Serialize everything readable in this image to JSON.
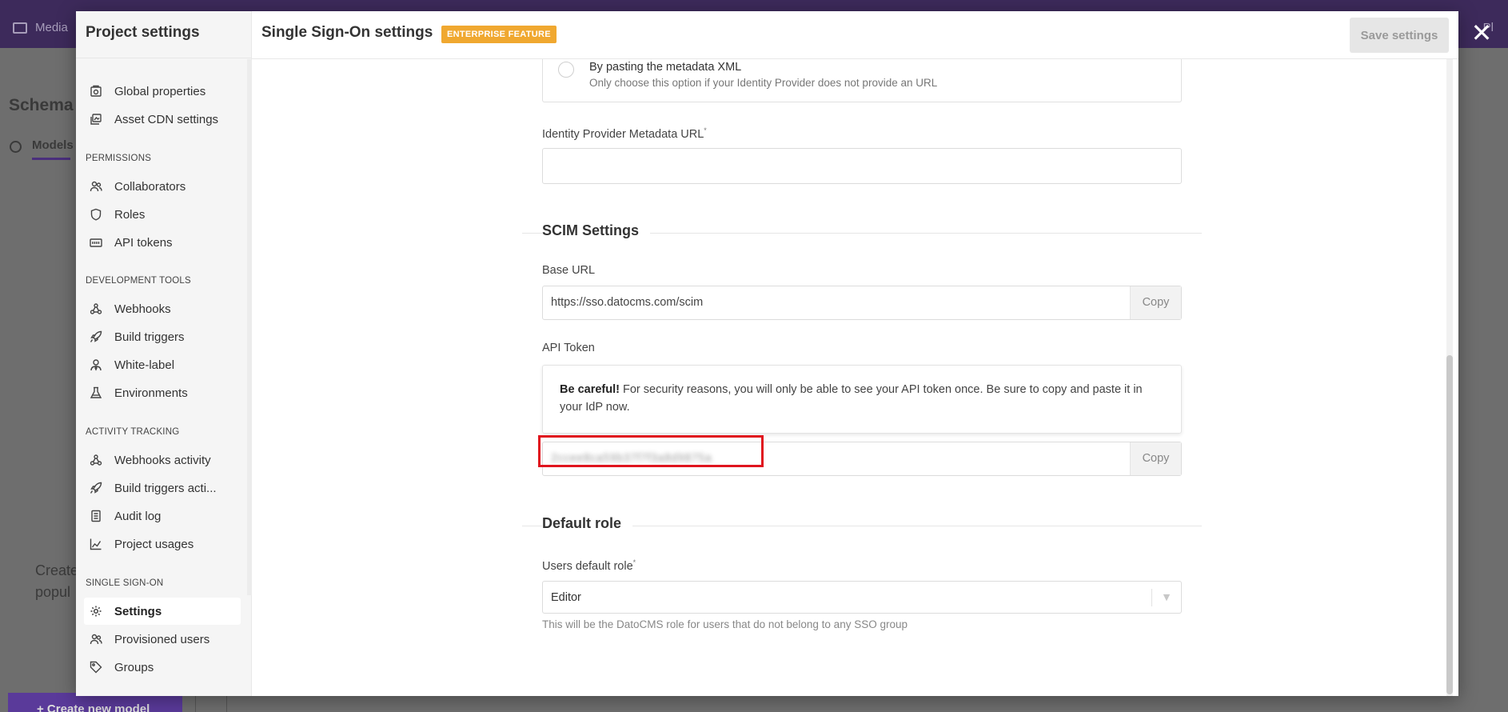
{
  "background": {
    "topbar_media_label": "Media",
    "topbar_right_label": "Pl",
    "schema_title": "Schema",
    "models_tab": "Models",
    "empty_text_line1": "Create",
    "empty_text_line2": "popul",
    "create_button": "+ Create new model"
  },
  "sidebar": {
    "title": "Project settings",
    "top_items": [
      {
        "label": "Global properties",
        "icon": "globe-doc-icon"
      },
      {
        "label": "Asset CDN settings",
        "icon": "images-icon"
      }
    ],
    "sections": [
      {
        "title": "PERMISSIONS",
        "items": [
          {
            "label": "Collaborators",
            "icon": "users-icon"
          },
          {
            "label": "Roles",
            "icon": "shield-icon"
          },
          {
            "label": "API tokens",
            "icon": "keyboard-icon"
          }
        ]
      },
      {
        "title": "DEVELOPMENT TOOLS",
        "items": [
          {
            "label": "Webhooks",
            "icon": "webhook-icon"
          },
          {
            "label": "Build triggers",
            "icon": "rocket-icon"
          },
          {
            "label": "White-label",
            "icon": "user-tie-icon"
          },
          {
            "label": "Environments",
            "icon": "flask-icon"
          }
        ]
      },
      {
        "title": "ACTIVITY TRACKING",
        "items": [
          {
            "label": "Webhooks activity",
            "icon": "webhook-icon"
          },
          {
            "label": "Build triggers acti...",
            "icon": "rocket-icon"
          },
          {
            "label": "Audit log",
            "icon": "clipboard-icon"
          },
          {
            "label": "Project usages",
            "icon": "chart-area-icon"
          }
        ]
      },
      {
        "title": "SINGLE SIGN-ON",
        "items": [
          {
            "label": "Settings",
            "icon": "gear-icon",
            "active": true
          },
          {
            "label": "Provisioned users",
            "icon": "users-icon"
          },
          {
            "label": "Groups",
            "icon": "tag-icon"
          }
        ]
      }
    ]
  },
  "header": {
    "title": "Single Sign-On settings",
    "badge": "ENTERPRISE FEATURE",
    "save_button": "Save settings"
  },
  "form": {
    "radio_title": "By pasting the metadata XML",
    "radio_description": "Only choose this option if your Identity Provider does not provide an URL",
    "metadata_url_label": "Identity Provider Metadata URL",
    "metadata_url_value": "",
    "required_mark": "*",
    "scim_section_title": "SCIM Settings",
    "base_url_label": "Base URL",
    "base_url_value": "https://sso.datocms.com/scim",
    "copy_label": "Copy",
    "api_token_label": "API Token",
    "warning_bold": "Be careful!",
    "warning_text": " For security reasons, you will only be able to see your API token once. Be sure to copy and paste it in your IdP now.",
    "api_token_value": "2ccee8ca59b37f7f3a8d9875a",
    "default_role_section_title": "Default role",
    "users_default_role_label": "Users default role",
    "users_default_role_value": "Editor",
    "users_default_role_hint": "This will be the DatoCMS role for users that do not belong to any SSO group"
  },
  "colors": {
    "badge": "#f0a830",
    "highlight": "#e0141e",
    "topbar": "#3d2a5b"
  }
}
